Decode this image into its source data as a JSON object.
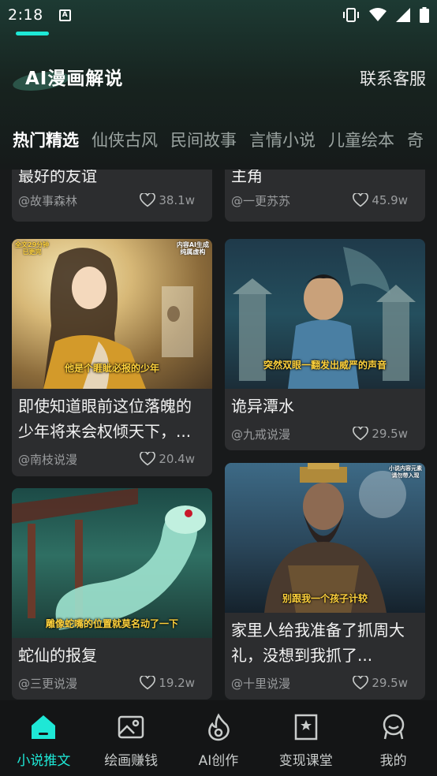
{
  "status_bar": {
    "time": "2:18",
    "notification_badge": "A"
  },
  "header": {
    "logo_text": "AI漫画解说",
    "contact_label": "联系客服"
  },
  "tabs": [
    {
      "label": "热门精选",
      "active": true
    },
    {
      "label": "仙侠古风",
      "active": false
    },
    {
      "label": "民间故事",
      "active": false
    },
    {
      "label": "言情小说",
      "active": false
    },
    {
      "label": "儿童绘本",
      "active": false
    },
    {
      "label": "奇",
      "active": false
    }
  ],
  "cards": [
    {
      "title": "最好的友谊",
      "author": "@故事森林",
      "likes": "38.1w"
    },
    {
      "title": "主角",
      "author": "@一更苏苏",
      "likes": "45.9w"
    },
    {
      "title": "即使知道眼前这位落魄的少年将来会权倾天下，...",
      "author": "@南枝说漫",
      "likes": "20.4w",
      "image_caption": "他是个睚眦必报的少年",
      "tag_left": "全文29分钟\n已更完",
      "tag_right": "内容AI生成\n纯属虚构"
    },
    {
      "title": "诡异潭水",
      "author": "@九戒说漫",
      "likes": "29.5w",
      "image_caption": "突然双眼一翻发出威严的声音"
    },
    {
      "title": "蛇仙的报复",
      "author": "@三更说漫",
      "likes": "19.2w",
      "image_caption": "雕像蛇嘴的位置就莫名动了一下"
    },
    {
      "title": "家里人给我准备了抓周大礼，没想到我抓了...",
      "author": "@十里说漫",
      "likes": "29.5w",
      "image_caption": "别跟我一个孩子计较",
      "tag_right": "小说内容元素\n请勿带入现"
    }
  ],
  "bottom_nav": [
    {
      "label": "小说推文",
      "icon": "home-icon",
      "active": true
    },
    {
      "label": "绘画赚钱",
      "icon": "image-icon",
      "active": false
    },
    {
      "label": "AI创作",
      "icon": "flame-icon",
      "active": false
    },
    {
      "label": "变现课堂",
      "icon": "bookmark-star-icon",
      "active": false
    },
    {
      "label": "我的",
      "icon": "profile-icon",
      "active": false
    }
  ],
  "colors": {
    "accent": "#1ee8d6",
    "card_bg": "#2c2d2f",
    "page_bg": "#181a1b"
  }
}
